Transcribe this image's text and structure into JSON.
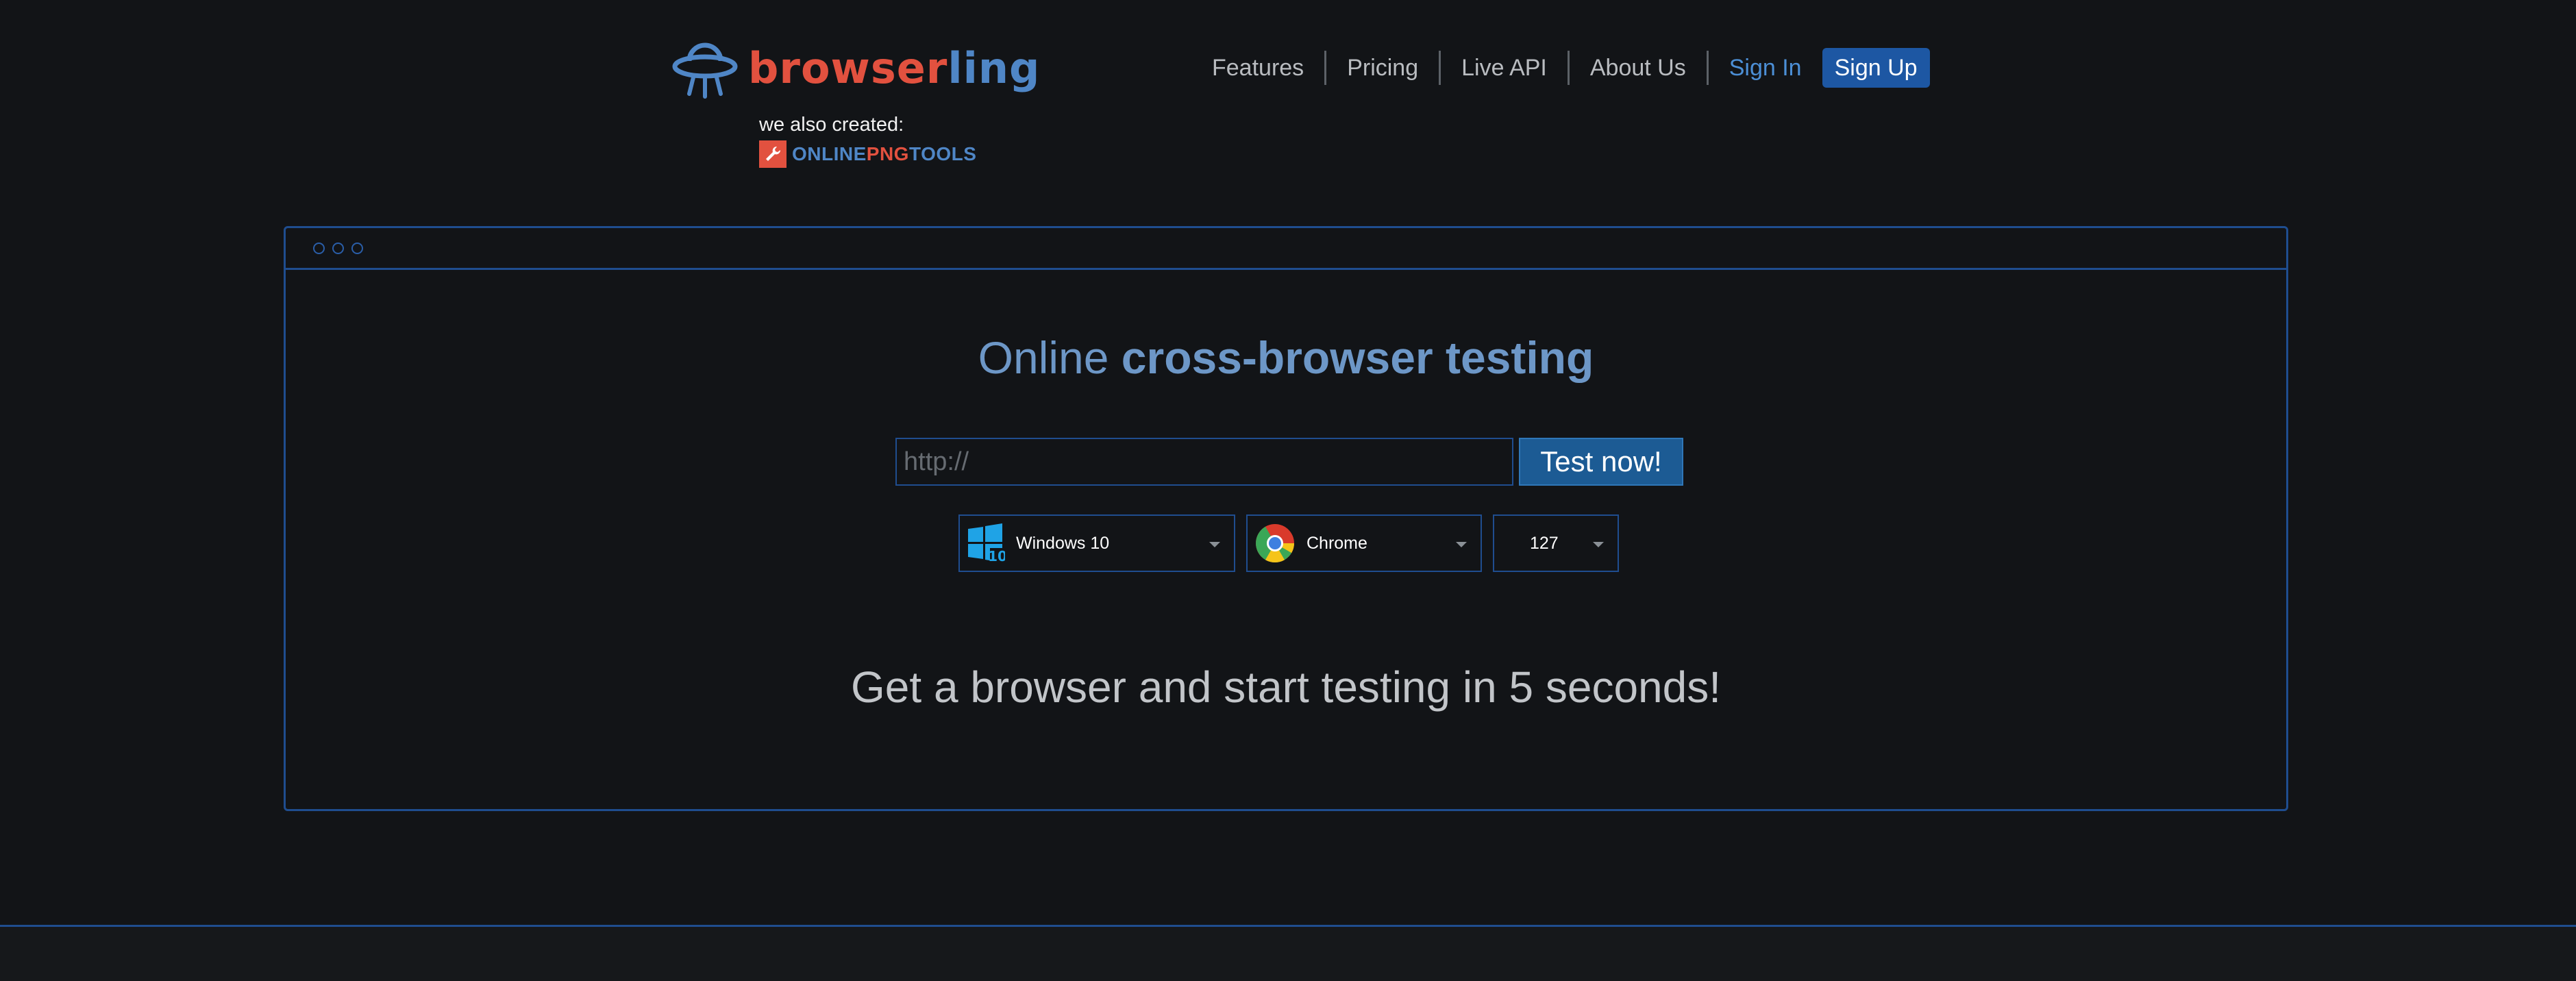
{
  "header": {
    "logo": {
      "part_a": "browser",
      "part_b": "ling",
      "icon": "ufo-icon"
    },
    "also_created": "we also created:",
    "png_tools": {
      "icon": "wrench-icon",
      "part_a": "ONLINE",
      "part_b": "PNG",
      "part_c": "TOOLS"
    },
    "nav": {
      "features": "Features",
      "pricing": "Pricing",
      "live_api": "Live API",
      "about_us": "About Us",
      "sign_in": "Sign In",
      "sign_up": "Sign Up"
    }
  },
  "main": {
    "headline_plain": "Online",
    "headline_strong": "cross-browser testing",
    "url_input": {
      "placeholder": "http://",
      "value": ""
    },
    "test_button": "Test now!",
    "os_select": {
      "icon": "windows-10-icon",
      "value": "Windows 10"
    },
    "browser_select": {
      "icon": "chrome-icon",
      "value": "Chrome"
    },
    "version_select": {
      "value": "127"
    },
    "tagline": "Get a browser and start testing in 5 seconds!"
  },
  "colors": {
    "background": "#121417",
    "brand_red": "#e2513f",
    "brand_blue": "#4f86c6",
    "frame_border": "#1f4d8f",
    "signup_bg": "#1d57a3",
    "test_button_bg": "#1c5b94"
  }
}
